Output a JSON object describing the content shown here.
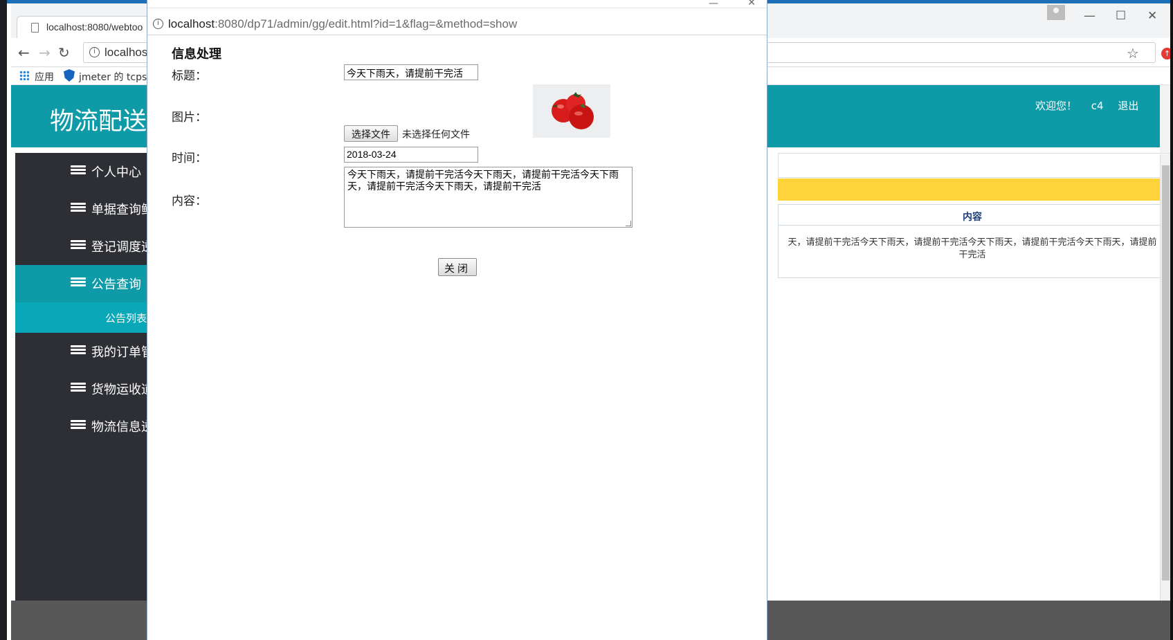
{
  "background_browser": {
    "tab_title": "localhost:8080/webtoo",
    "address": "localhos",
    "bookmarks": {
      "apps_label": "应用",
      "jmeter_label": "jmeter 的 tcpsa"
    }
  },
  "site": {
    "title": "物流配送",
    "welcome": "欢迎您！",
    "user": "c4",
    "logout": "退出"
  },
  "sidebar": {
    "items": [
      {
        "label": "个人中心",
        "active": false
      },
      {
        "label": "单据查询鲜",
        "active": false
      },
      {
        "label": "登记调度逆",
        "active": false
      },
      {
        "label": "公告查询",
        "active": true
      },
      {
        "label": "我的订单管",
        "active": false
      },
      {
        "label": "货物运收道",
        "active": false
      },
      {
        "label": "物流信息逆",
        "active": false
      }
    ],
    "submenu_label": "公告列表"
  },
  "content_table": {
    "header": "内容",
    "cell_text": "天，请提前干完活今天下雨天，请提前干完活今天下雨天，请提前干完活今天下雨天，请提前干完活"
  },
  "popup": {
    "address_host": "localhost",
    "address_path": ":8080/dp71/admin/gg/edit.html?id=1&flag=&method=show",
    "form_title": "信息处理",
    "labels": {
      "title": "标题：",
      "image": "图片：",
      "time": "时间：",
      "content": "内容："
    },
    "title_value": "今天下雨天，请提前干完活",
    "choose_file_label": "选择文件",
    "no_file_label": "未选择任何文件",
    "time_value": "2018-03-24",
    "content_value": "今天下雨天，请提前干完活今天下雨天，请提前干完活今天下雨天，请提前干完活今天下雨天，请提前干完活",
    "close_label": "关闭"
  },
  "colors": {
    "teal": "#0f9aa8",
    "sidebar_dark": "#2d2f35",
    "yellow": "#ffd43b"
  }
}
